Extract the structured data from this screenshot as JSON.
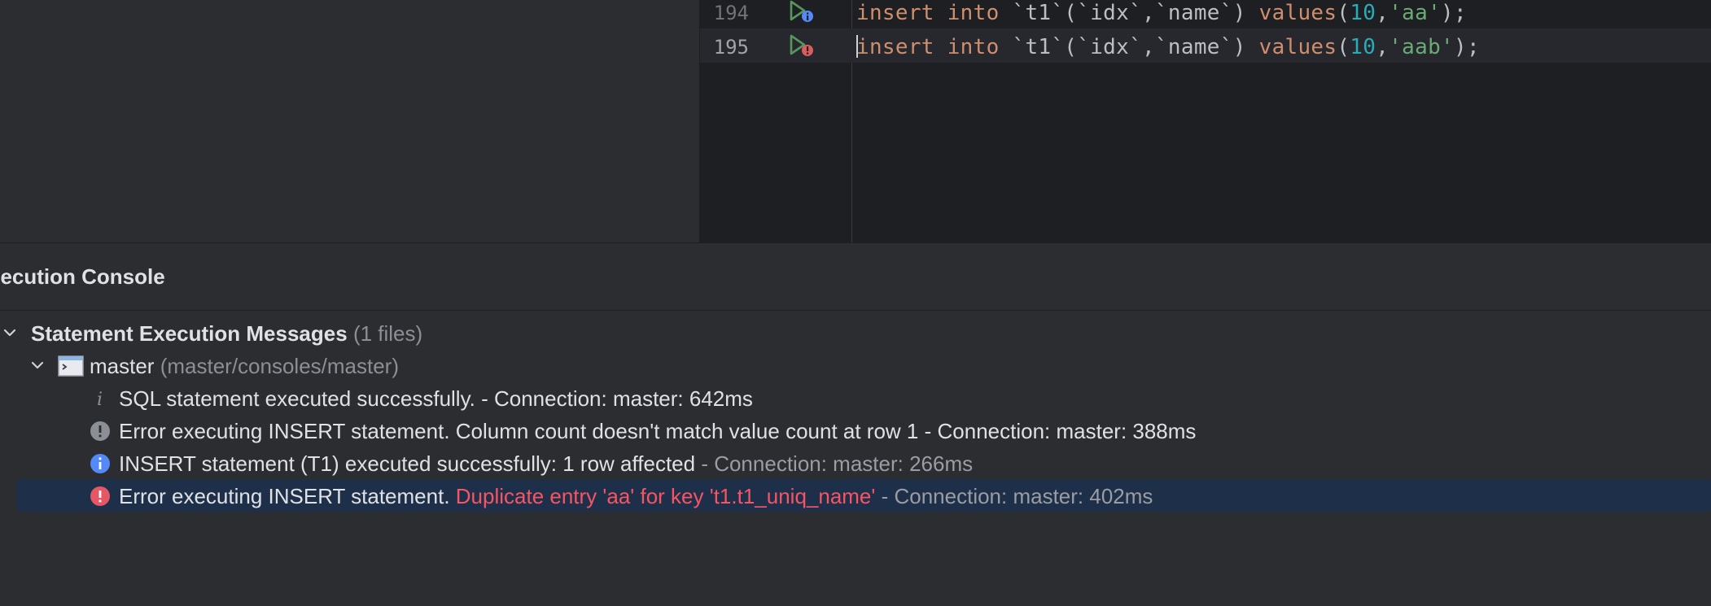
{
  "editor": {
    "lines": [
      {
        "number": "194",
        "run_status": "info",
        "tokens": [
          {
            "t": "insert",
            "c": "kw"
          },
          {
            "t": " ",
            "c": ""
          },
          {
            "t": "into",
            "c": "kw"
          },
          {
            "t": " `t1`(`idx`,`name`) ",
            "c": ""
          },
          {
            "t": "values",
            "c": "fn"
          },
          {
            "t": "(",
            "c": ""
          },
          {
            "t": "10",
            "c": "num"
          },
          {
            "t": ",",
            "c": ""
          },
          {
            "t": "'aa'",
            "c": "str"
          },
          {
            "t": ");",
            "c": ""
          }
        ]
      },
      {
        "number": "195",
        "run_status": "error",
        "tokens": [
          {
            "t": "insert",
            "c": "kw"
          },
          {
            "t": " ",
            "c": ""
          },
          {
            "t": "into",
            "c": "kw"
          },
          {
            "t": " `t1`(`idx`,`name`) ",
            "c": ""
          },
          {
            "t": "values",
            "c": "fn"
          },
          {
            "t": "(",
            "c": ""
          },
          {
            "t": "10",
            "c": "num"
          },
          {
            "t": ",",
            "c": ""
          },
          {
            "t": "'aab'",
            "c": "str"
          },
          {
            "t": ");",
            "c": ""
          }
        ]
      }
    ]
  },
  "console": {
    "title": "xecution Console",
    "root": {
      "label": "Statement Execution Messages",
      "count": "(1 files)"
    },
    "session": {
      "label": "master",
      "path": "(master/consoles/master)"
    },
    "messages": [
      {
        "icon": "info-italic-icon",
        "main": "SQL statement executed successfully.",
        "detail": "",
        "suffix": " - Connection: master: 642ms",
        "style": "dim"
      },
      {
        "icon": "warning-gray-icon",
        "main": "Error executing INSERT statement. Column count doesn't match value count at row 1",
        "detail": "",
        "suffix": " - Connection: master: 388ms",
        "style": "dim"
      },
      {
        "icon": "info-blue-icon",
        "main": "INSERT statement (T1) executed successfully: 1 row affected",
        "detail": "",
        "suffix": " - Connection: master: 266ms",
        "style": "normal"
      },
      {
        "icon": "error-red-icon",
        "main": "Error executing INSERT statement. ",
        "detail": "Duplicate entry 'aa' for key 't1.t1_uniq_name'",
        "suffix": " - Connection: master: 402ms",
        "style": "normal",
        "selected": true
      }
    ]
  },
  "colors": {
    "background": "#2b2d30",
    "editor_bg": "#1e1f22",
    "keyword": "#cf8e6d",
    "number": "#2aacb8",
    "string": "#6aab73",
    "error_text": "#f75464",
    "selection": "#1e3049",
    "info_blue": "#548af7"
  }
}
